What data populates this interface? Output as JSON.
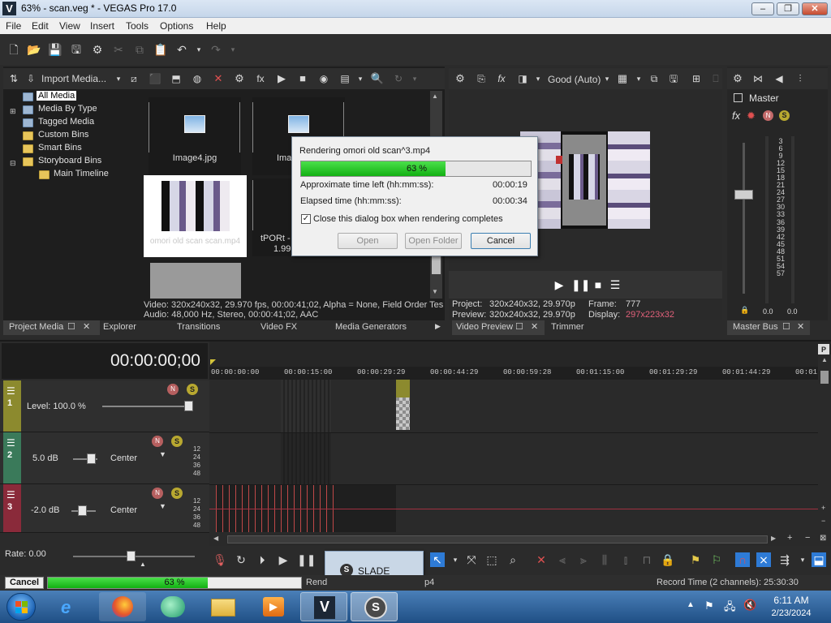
{
  "window": {
    "title": "63% - scan.veg * - VEGAS Pro 17.0",
    "app_icon": "V"
  },
  "menu": [
    "File",
    "Edit",
    "View",
    "Insert",
    "Tools",
    "Options",
    "Help"
  ],
  "media_toolbar": {
    "import_label": "Import Media..."
  },
  "tree": {
    "items": [
      "All Media",
      "Media By Type",
      "Tagged Media",
      "Custom Bins",
      "Smart Bins",
      "Storyboard Bins",
      "Main Timeline"
    ]
  },
  "media": {
    "items": [
      "Image4.jpg",
      "Ima",
      "omori old scan scan.mp4",
      "tPORt -",
      "1.99"
    ],
    "info_video": "Video: 320x240x32, 29.970 fps, 00:00:41;02, Alpha = None, Field Order Tes",
    "info_audio": "Audio: 48,000 Hz, Stereo, 00:00:41;02, AAC"
  },
  "left_tabs": [
    "Project Media",
    "Explorer",
    "Transitions",
    "Video FX",
    "Media Generators"
  ],
  "preview": {
    "quality": "Good (Auto)",
    "project_label": "Project:",
    "project_value": "320x240x32, 29.970p",
    "preview_label": "Preview:",
    "preview_value": "320x240x32, 29.970p",
    "frame_label": "Frame:",
    "frame_value": "777",
    "display_label": "Display:",
    "display_value": "297x223x32",
    "tabs": [
      "Video Preview",
      "Trimmer"
    ]
  },
  "master": {
    "title": "Master",
    "scale": [
      "3",
      "6",
      "9",
      "12",
      "15",
      "18",
      "21",
      "24",
      "27",
      "30",
      "33",
      "36",
      "39",
      "42",
      "45",
      "48",
      "51",
      "54",
      "57"
    ],
    "left_value": "0.0",
    "right_value": "0.0",
    "tab": "Master Bus"
  },
  "dialog": {
    "title": "Rendering omori old scan^3.mp4",
    "progress_text": "63 %",
    "progress": 0.63,
    "time_left_label": "Approximate time left (hh:mm:ss):",
    "time_left_value": "00:00:19",
    "elapsed_label": "Elapsed time (hh:mm:ss):",
    "elapsed_value": "00:00:34",
    "checkbox_label": "Close this dialog box when rendering completes",
    "checkbox_checked": true,
    "open_label": "Open",
    "open_folder_label": "Open Folder",
    "cancel_label": "Cancel"
  },
  "timeline": {
    "timecode": "00:00:00;00",
    "ruler": [
      "00:00:00:00",
      "00:00:15:00",
      "00:00:29:29",
      "00:00:44:29",
      "00:00:59:28",
      "00:01:15:00",
      "00:01:29:29",
      "00:01:44:29",
      "00:01"
    ],
    "tracks": [
      {
        "num": "1",
        "level_label": "Level: 100.0 %"
      },
      {
        "num": "2",
        "volume": "5.0 dB",
        "pan": "Center",
        "meter": [
          "12",
          "24",
          "36",
          "48"
        ]
      },
      {
        "num": "3",
        "volume": "-2.0 dB",
        "pan": "Center",
        "meter": [
          "12",
          "24",
          "36",
          "48"
        ]
      }
    ],
    "rate_label": "Rate: 0.00"
  },
  "status": {
    "cancel_label": "Cancel",
    "progress_text": "63 %",
    "progress": 0.63,
    "render_label": "Rend",
    "render_suffix": "p4",
    "record_time": "Record Time (2 channels): 25:30:30"
  },
  "popup": {
    "label": "SLADE"
  },
  "taskbar": {
    "time": "6:11 AM",
    "date": "2/23/2024"
  },
  "colors": {
    "accent_green": "#1db81d",
    "track1": "#8c8a2e",
    "track2": "#3a7a5a",
    "track3": "#8a2a3a"
  }
}
